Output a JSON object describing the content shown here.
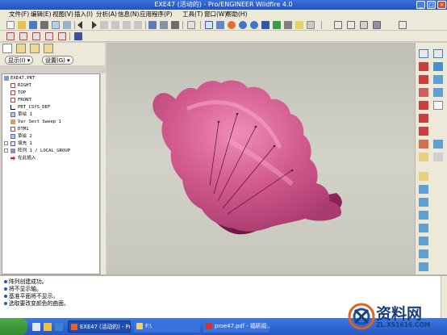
{
  "window": {
    "title": "EXE47 (活动的) - Pro/ENGINEER Wildfire 4.0"
  },
  "menu": [
    "文件(F)",
    "编辑(E)",
    "视图(V)",
    "插入(I)",
    "分析(A)",
    "信息(N)",
    "应用程序(P)",
    "工具(T)",
    "窗口(W)",
    "帮助(H)"
  ],
  "navigator": {
    "show_label": "显示(I) ▾",
    "settings_label": "设置(G) ▾"
  },
  "tree": [
    {
      "label": "EXE47.PRT",
      "icon": "part-icon",
      "level": 0
    },
    {
      "label": "RIGHT",
      "icon": "datum-plane-icon",
      "level": 1
    },
    {
      "label": "TOP",
      "icon": "datum-plane-icon",
      "level": 1
    },
    {
      "label": "FRONT",
      "icon": "datum-plane-icon",
      "level": 1
    },
    {
      "label": "PRT_CSYS_DEF",
      "icon": "csys-icon",
      "level": 1
    },
    {
      "label": "草绘 1",
      "icon": "sketch-icon",
      "level": 1
    },
    {
      "label": "Var Sect Sweep 1",
      "icon": "sweep-icon",
      "level": 1
    },
    {
      "label": "DTM1",
      "icon": "datum-plane-icon",
      "level": 1
    },
    {
      "label": "草绘 2",
      "icon": "sketch-icon",
      "level": 1
    },
    {
      "label": "填充 1",
      "icon": "fill-icon",
      "level": 1
    },
    {
      "label": "阵列 1 / LOCAL_GROUP",
      "icon": "pattern-icon",
      "level": 1
    },
    {
      "label": "在此插入",
      "icon": "insert-arrow-icon",
      "level": 1
    }
  ],
  "messages": [
    "阵列创建成功。",
    "将不显示轴。",
    "基准平面将不显示。",
    "选取要改变颜色的曲面。"
  ],
  "taskbar": {
    "items": [
      "EXE47 (活动的) - Pro...",
      "F:\\",
      "proe47.pdf - 福昕阅..."
    ]
  },
  "watermark": {
    "text": "资料网",
    "url": "ZL.XS1616.COM"
  },
  "colors": {
    "model_pink": "#d25a8e",
    "model_dark": "#8a2156",
    "viewport_bg": "#cfcdc3",
    "title_blue": "#2a5bc9"
  }
}
